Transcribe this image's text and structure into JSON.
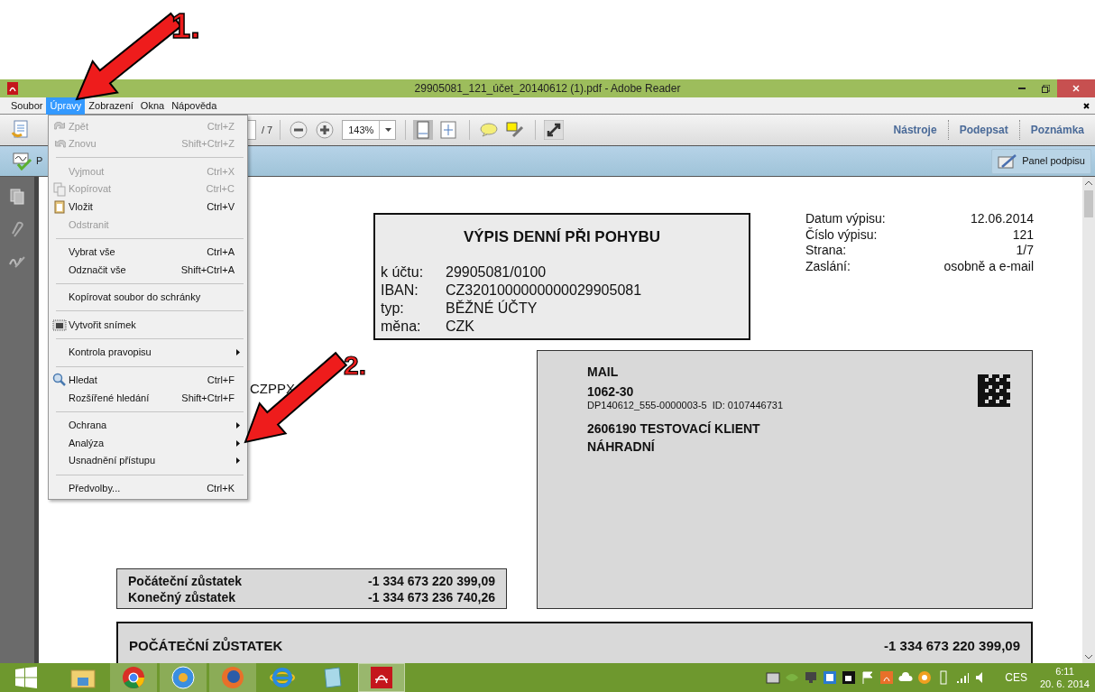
{
  "annotations": [
    {
      "label": "1."
    },
    {
      "label": "2."
    }
  ],
  "window": {
    "title": "29905081_121_účet_20140612 (1).pdf - Adobe Reader"
  },
  "menu_bar": [
    {
      "label": "Soubor",
      "selected": false
    },
    {
      "label": "Úpravy",
      "selected": true
    },
    {
      "label": "Zobrazení",
      "selected": false
    },
    {
      "label": "Okna",
      "selected": false
    },
    {
      "label": "Nápověda",
      "selected": false
    }
  ],
  "toolbar": {
    "page_total": "/ 7",
    "zoom": "143%",
    "right_buttons": [
      "Nástroje",
      "Podepsat",
      "Poznámka"
    ]
  },
  "sign_bar": {
    "partial_label": "P",
    "button": "Panel podpisu"
  },
  "edit_menu": [
    {
      "kind": "item",
      "label": "Zpět",
      "shortcut": "Ctrl+Z",
      "disabled": true,
      "submenu": false
    },
    {
      "kind": "item",
      "label": "Znovu",
      "shortcut": "Shift+Ctrl+Z",
      "disabled": true,
      "submenu": false
    },
    {
      "kind": "separator"
    },
    {
      "kind": "item",
      "label": "Vyjmout",
      "shortcut": "Ctrl+X",
      "disabled": true,
      "submenu": false
    },
    {
      "kind": "item",
      "label": "Kopírovat",
      "shortcut": "Ctrl+C",
      "disabled": true,
      "submenu": false
    },
    {
      "kind": "item",
      "label": "Vložit",
      "shortcut": "Ctrl+V",
      "disabled": false,
      "submenu": false
    },
    {
      "kind": "item",
      "label": "Odstranit",
      "disabled": true,
      "submenu": false
    },
    {
      "kind": "separator"
    },
    {
      "kind": "item",
      "label": "Vybrat vše",
      "shortcut": "Ctrl+A",
      "disabled": false,
      "submenu": false
    },
    {
      "kind": "item",
      "label": "Odznačit vše",
      "shortcut": "Shift+Ctrl+A",
      "disabled": false,
      "submenu": false
    },
    {
      "kind": "separator"
    },
    {
      "kind": "item",
      "label": "Kopírovat soubor do schránky",
      "disabled": false,
      "submenu": false
    },
    {
      "kind": "separator"
    },
    {
      "kind": "item",
      "label": "Vytvořit snímek",
      "disabled": false,
      "submenu": false
    },
    {
      "kind": "separator"
    },
    {
      "kind": "item",
      "label": "Kontrola pravopisu",
      "disabled": false,
      "submenu": true
    },
    {
      "kind": "separator"
    },
    {
      "kind": "item",
      "label": "Hledat",
      "shortcut": "Ctrl+F",
      "disabled": false,
      "submenu": false
    },
    {
      "kind": "item",
      "label": "Rozšířené hledání",
      "shortcut": "Shift+Ctrl+F",
      "disabled": false,
      "submenu": false
    },
    {
      "kind": "separator"
    },
    {
      "kind": "item",
      "label": "Ochrana",
      "disabled": false,
      "submenu": true
    },
    {
      "kind": "item",
      "label": "Analýza",
      "disabled": false,
      "submenu": true
    },
    {
      "kind": "item",
      "label": "Usnadnění přístupu",
      "disabled": false,
      "submenu": true
    },
    {
      "kind": "separator"
    },
    {
      "kind": "item",
      "label": "Předvolby...",
      "shortcut": "Ctrl+K",
      "disabled": false,
      "submenu": false
    }
  ],
  "document": {
    "statement": {
      "title": "VÝPIS DENNÍ PŘI POHYBU",
      "rows": [
        {
          "label": "k účtu:",
          "value": "29905081/0100"
        },
        {
          "label": "IBAN:",
          "value": "CZ3201000000000029905081"
        },
        {
          "label": "typ:",
          "value": "BĚŽNÉ ÚČTY"
        },
        {
          "label": "měna:",
          "value": "CZK"
        }
      ]
    },
    "info": [
      {
        "label": "Datum výpisu:",
        "value": "12.06.2014"
      },
      {
        "label": "Číslo výpisu:",
        "value": "121"
      },
      {
        "label": "Strana:",
        "value": "1/7"
      },
      {
        "label": "Zaslání:",
        "value": "osobně a e-mail"
      }
    ],
    "partial_text": "CZPPX",
    "address": {
      "type": "MAIL",
      "code": "1062-30",
      "reference": "DP140612_555-0000003-5",
      "id": "ID: 0107446731",
      "name": "2606190 TESTOVACÍ KLIENT",
      "line_2": "NÁHRADNÍ"
    },
    "balances": [
      {
        "label": "Počáteční zůstatek",
        "value": "-1 334 673 220 399,09"
      },
      {
        "label": "Konečný zůstatek",
        "value": "-1 334 673 236 740,26"
      }
    ],
    "opening": {
      "label": "POČÁTEČNÍ ZŮSTATEK",
      "value": "-1 334 673 220 399,09"
    }
  },
  "taskbar": {
    "language": "CES",
    "time": "6:11",
    "date": "20. 6. 2014"
  }
}
